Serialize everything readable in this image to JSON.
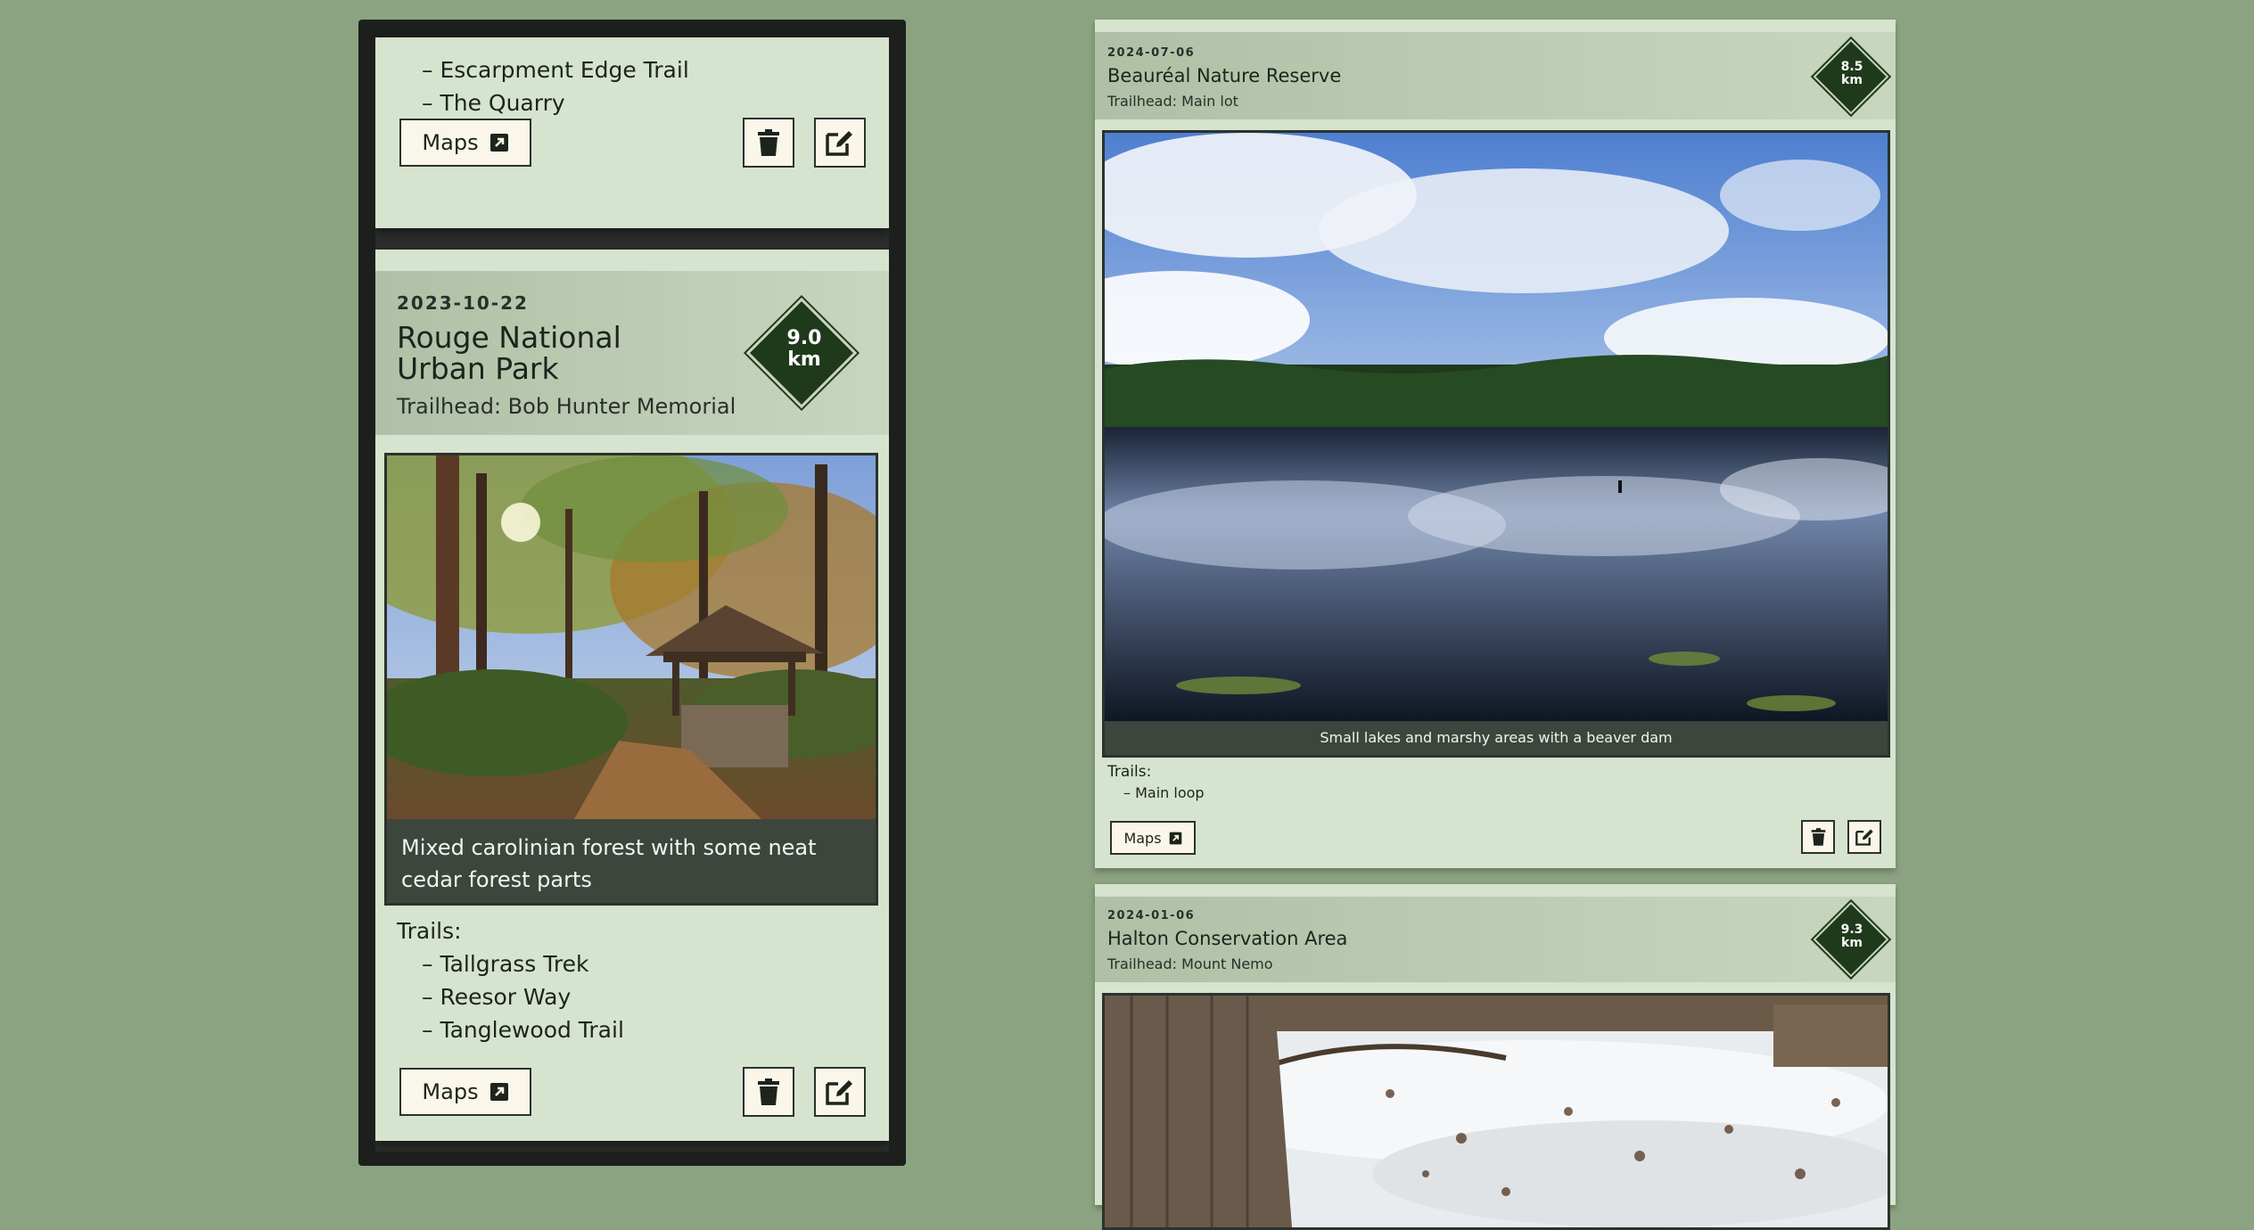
{
  "phone": {
    "top_card": {
      "trails": [
        "Escarpment Edge Trail",
        "The Quarry"
      ],
      "maps_label": "Maps"
    },
    "rouge_card": {
      "date": "2023-10-22",
      "title_line1": "Rouge National",
      "title_line2": "Urban Park",
      "trailhead": "Trailhead: Bob Hunter Memorial",
      "distance_value": "9.0",
      "distance_unit": "km",
      "caption": "Mixed carolinian forest with some neat cedar forest parts",
      "trails_label": "Trails:",
      "trails": [
        "Tallgrass Trek",
        "Reesor Way",
        "Tanglewood Trail"
      ],
      "maps_label": "Maps"
    }
  },
  "desktop": {
    "beaureal_card": {
      "date": "2024-07-06",
      "title": "Beauréal Nature Reserve",
      "trailhead": "Trailhead: Main lot",
      "distance_value": "8.5",
      "distance_unit": "km",
      "caption": "Small lakes and marshy areas with a beaver dam",
      "trails_label": "Trails:",
      "trails": [
        "Main loop"
      ],
      "maps_label": "Maps"
    },
    "halton_card": {
      "date": "2024-01-06",
      "title": "Halton Conservation Area",
      "trailhead": "Trailhead: Mount Nemo",
      "distance_value": "9.3",
      "distance_unit": "km"
    }
  },
  "icons": {
    "external_link": "external-link-icon",
    "delete": "trash-icon",
    "edit": "edit-icon"
  },
  "colors": {
    "background": "#8ba380",
    "card": "#d6e4cf",
    "diamond": "#1f3a1b",
    "caption_bg": "#3d463d",
    "button_bg": "#fbf6ea"
  }
}
